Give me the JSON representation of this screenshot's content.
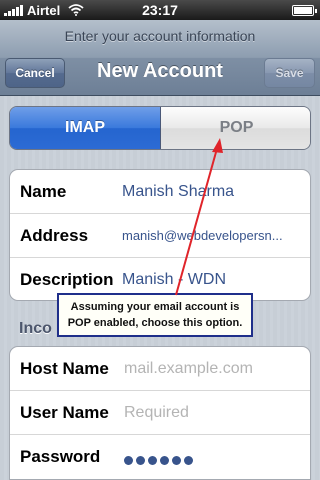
{
  "status_bar": {
    "carrier": "Airtel",
    "time": "23:17",
    "icons": [
      "signal-icon",
      "wifi-icon",
      "battery-icon"
    ]
  },
  "nav": {
    "prompt": "Enter your account information",
    "title": "New Account",
    "cancel_label": "Cancel",
    "save_label": "Save"
  },
  "segment": {
    "options": [
      "IMAP",
      "POP"
    ],
    "selected": "IMAP"
  },
  "account": {
    "name_label": "Name",
    "name_value": "Manish Sharma",
    "address_label": "Address",
    "address_value": "manish@webdevelopersn...",
    "description_label": "Description",
    "description_value": "Manish - WDN"
  },
  "incoming": {
    "header": "Inco",
    "host_label": "Host Name",
    "host_placeholder": "mail.example.com",
    "user_label": "User Name",
    "user_placeholder": "Required",
    "password_label": "Password",
    "password_masked": "••••••"
  },
  "callout": {
    "text": "Assuming your email account is POP enabled, choose this option."
  },
  "colors": {
    "accent": "#2c6bd4",
    "value_text": "#38548c",
    "annotation_arrow": "#e0242a",
    "callout_border": "#1f2f8a"
  }
}
